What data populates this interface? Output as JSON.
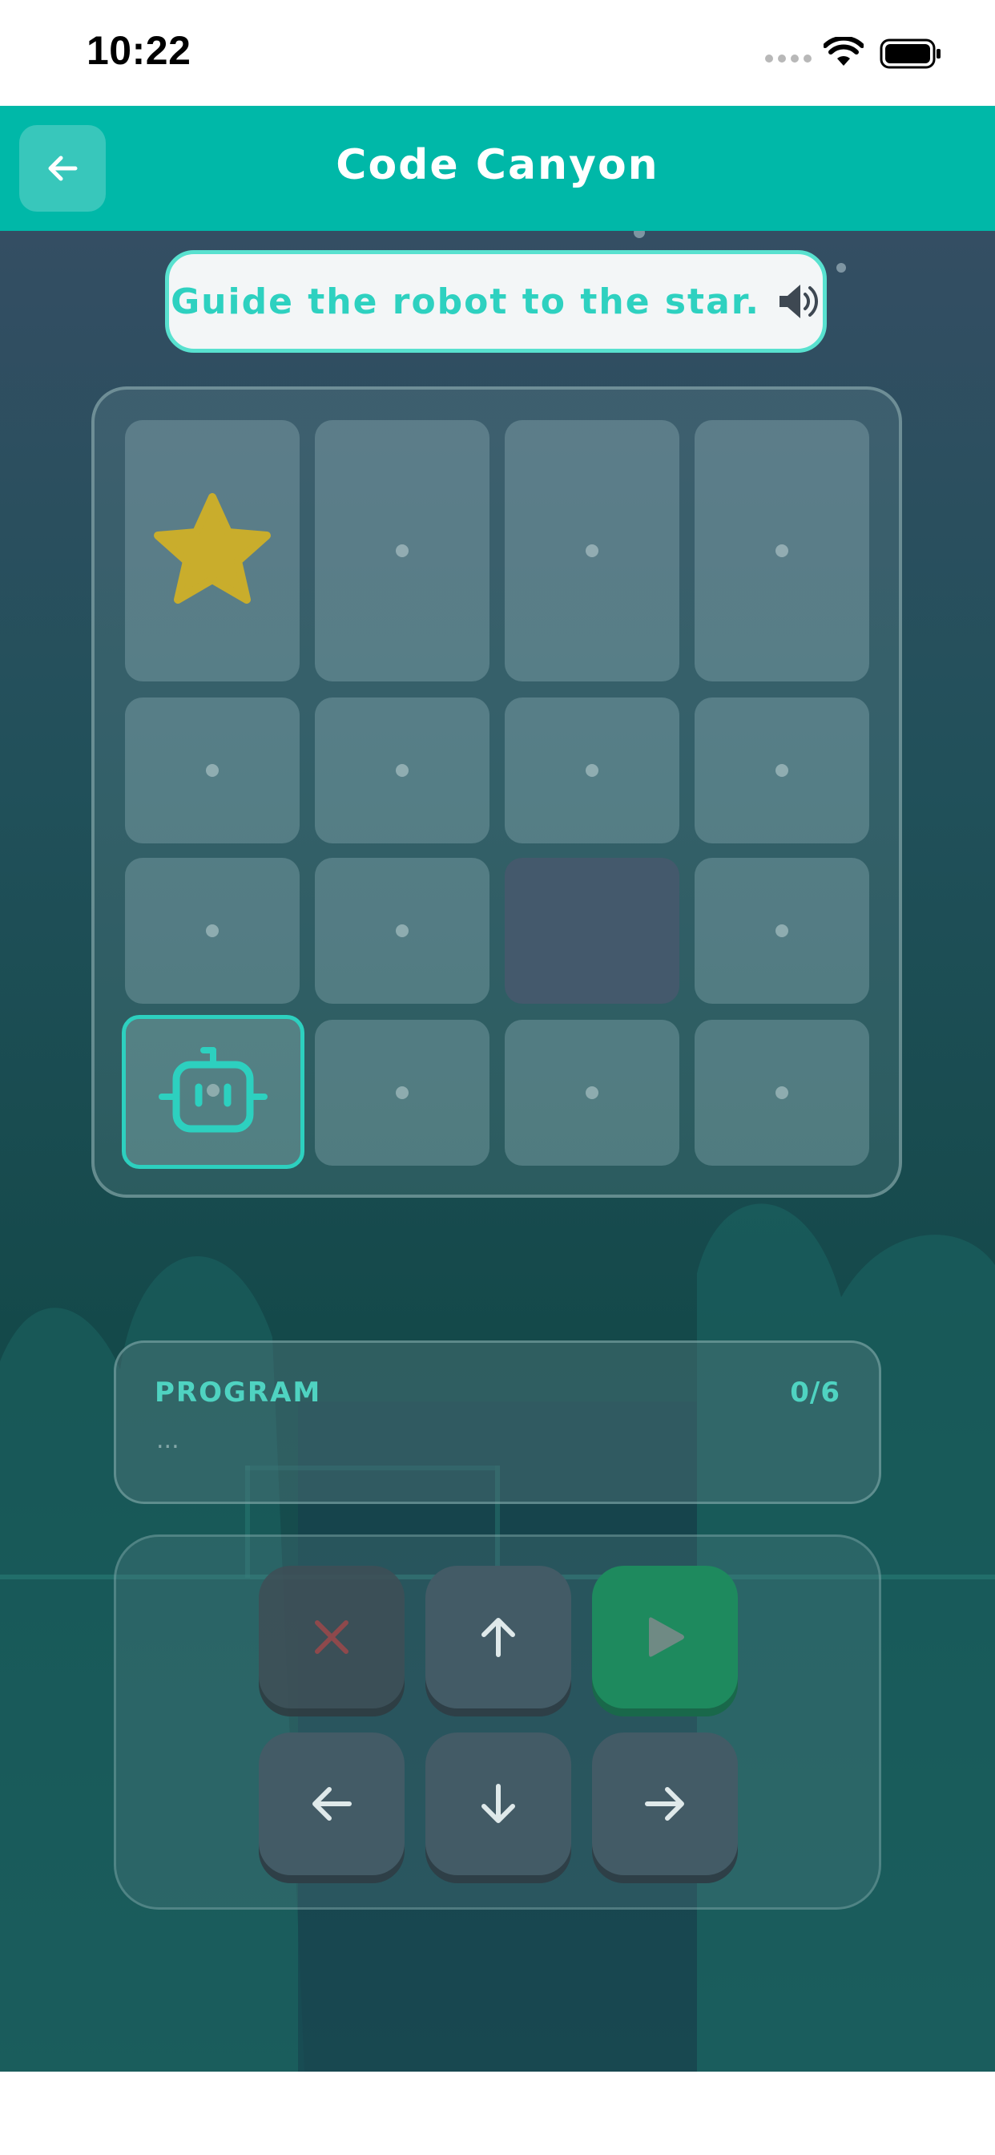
{
  "status_bar": {
    "time": "10:22"
  },
  "header": {
    "title": "Code Canyon"
  },
  "instruction": {
    "text": "Guide the robot to the star."
  },
  "board": {
    "rows": 4,
    "cols": 4,
    "goal": {
      "row": 1,
      "col": 1
    },
    "robot": {
      "row": 4,
      "col": 1
    },
    "blocked": [
      {
        "row": 3,
        "col": 3
      }
    ]
  },
  "program": {
    "label": "PROGRAM",
    "count": "0/6",
    "placeholder": "..."
  },
  "controls": [
    "clear",
    "up",
    "run",
    "left",
    "down",
    "right"
  ],
  "colors": {
    "accent": "#00b8a8",
    "instruction_text": "#2ed1c0",
    "star": "#c9ad2c",
    "run_button": "#1e8a5e",
    "clear_icon": "#a0474a"
  },
  "icons": {
    "back": "arrow-left-icon",
    "speaker": "speaker-icon",
    "goal": "star-icon",
    "player": "robot-icon"
  }
}
